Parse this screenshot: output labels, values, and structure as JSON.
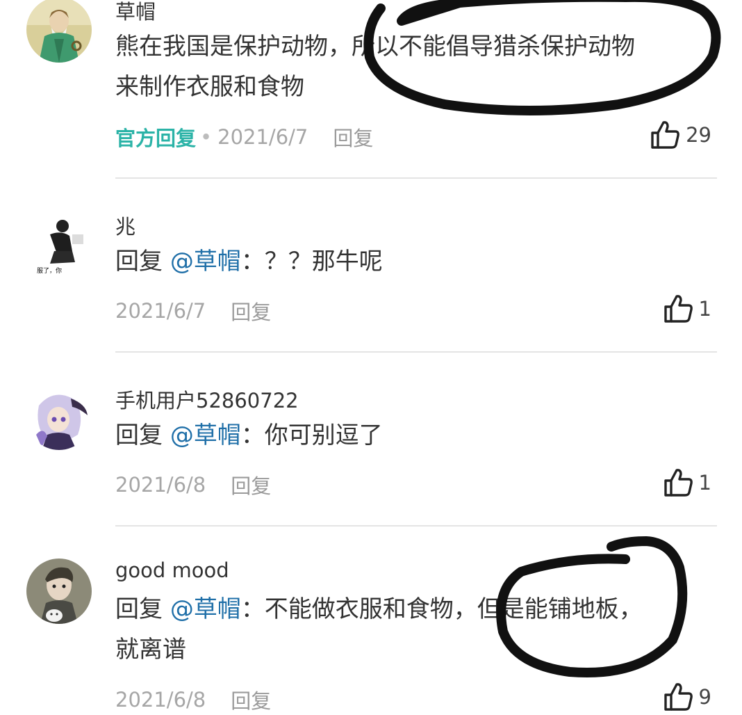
{
  "comments": [
    {
      "username": "草帽",
      "body_line1": "熊在我国是保护动物，所以不能倡导猎杀保护动物",
      "body_line2": "来制作衣服和食物",
      "official_label": "官方回复",
      "separator": "•",
      "date": "2021/6/7",
      "reply_label": "回复",
      "likes": "29"
    },
    {
      "username": "兆",
      "reply_prefix": "回复 ",
      "mention": "@草帽",
      "text": "：？？那牛呢",
      "avatar_caption": "服了，你",
      "date": "2021/6/7",
      "reply_label": "回复",
      "likes": "1"
    },
    {
      "username": "手机用户52860722",
      "reply_prefix": "回复 ",
      "mention": "@草帽",
      "text": "：你可别逗了",
      "date": "2021/6/8",
      "reply_label": "回复",
      "likes": "1"
    },
    {
      "username": "good mood",
      "reply_prefix": "回复 ",
      "mention": "@草帽",
      "text": "：不能做衣服和食物，但是能铺地板，",
      "text_line2": "就离谱",
      "date": "2021/6/8",
      "reply_label": "回复",
      "likes": "9"
    }
  ],
  "icons": {
    "like": "thumbs-up-icon"
  },
  "colors": {
    "official_reply": "#2bb3a7",
    "mention": "#1f6fa8",
    "meta_text": "#a6a6a6",
    "annotation_ink": "#111111"
  }
}
